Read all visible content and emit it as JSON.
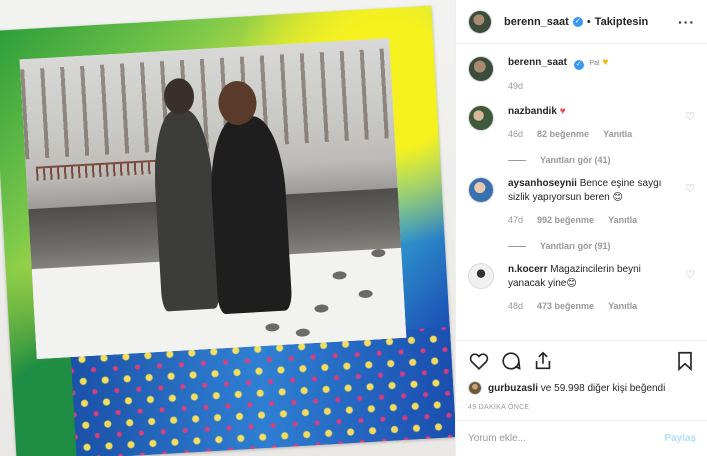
{
  "header": {
    "username": "berenn_saat",
    "separator": "•",
    "follow_status": "Takiptesin",
    "more_icon": "more-horizontal-icon"
  },
  "caption": {
    "username": "berenn_saat",
    "text": "Pal",
    "emoji": "♥",
    "age": "49d"
  },
  "comments": [
    {
      "username": "nazbandik",
      "text": "♥",
      "age": "46d",
      "likes": "82 beğenme",
      "reply": "Yanıtla",
      "replies": "Yanıtları gör (41)"
    },
    {
      "username": "aysanhoseynii",
      "text": "Bence eşine saygı sizlik yapıyorsun beren 😊",
      "age": "47d",
      "likes": "992 beğenme",
      "reply": "Yanıtla",
      "replies": "Yanıtları gör (91)"
    },
    {
      "username": "n.kocerr",
      "text": "Magazincilerin beyni yanacak yine😊",
      "age": "48d",
      "likes": "473 beğenme",
      "reply": "Yanıtla"
    }
  ],
  "actions": {
    "liked_by_user": "gurbuzasli",
    "liked_by_rest": " ve 59.998 diğer kişi beğendi",
    "timestamp": "49 DAKİKA ÖNCE"
  },
  "add_comment": {
    "placeholder": "Yorum ekle...",
    "post_label": "Paylaş"
  },
  "colors": {
    "verified": "#3897f0",
    "like_heart": "#ed4956",
    "post_disabled": "#b2dffc"
  }
}
